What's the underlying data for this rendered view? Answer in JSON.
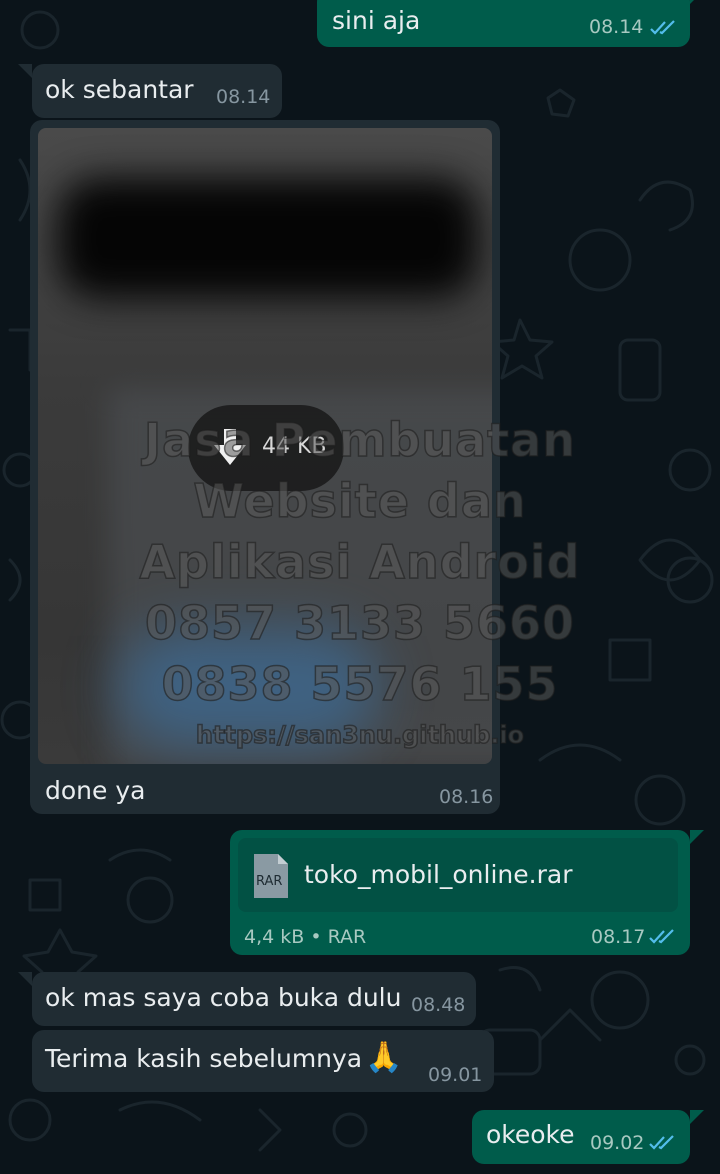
{
  "messages": {
    "m1": {
      "text": "sini aja",
      "time": "08.14"
    },
    "m2": {
      "text": "ok sebantar",
      "time": "08.14"
    },
    "m3": {
      "caption": "done ya",
      "time": "08.16",
      "download_size": "44 KB",
      "watermark": [
        "Jasa Pembuatan",
        "Website dan",
        "Aplikasi Android",
        "0857 3133 5660",
        "0838 5576 155",
        "https://san3nu.github.io"
      ]
    },
    "m4": {
      "file_icon_label": "RAR",
      "file_name": "toko_mobil_online.rar",
      "file_meta": "4,4 kB • RAR",
      "time": "08.17"
    },
    "m5": {
      "text": "ok mas saya coba buka dulu",
      "time": "08.48"
    },
    "m6": {
      "text": "Terima kasih sebelumnya",
      "emoji": "🙏",
      "time": "09.01"
    },
    "m7": {
      "text": "okeoke",
      "time": "09.02"
    }
  },
  "colors": {
    "background": "#0b141a",
    "incoming_bubble": "#202c33",
    "outgoing_bubble": "#005c4b",
    "read_ticks": "#53bdeb"
  },
  "icons": [
    "double-check-icon",
    "download-icon",
    "rar-file-icon",
    "folded-hands-emoji"
  ]
}
